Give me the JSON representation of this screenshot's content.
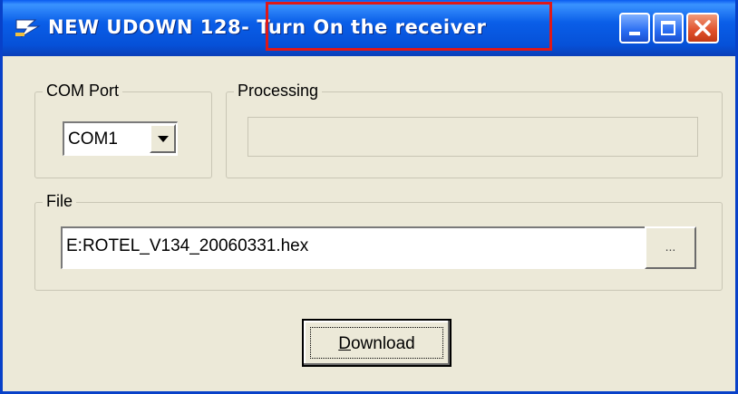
{
  "window": {
    "title": "NEW UDOWN 128-",
    "status": "Turn On the receiver"
  },
  "com_port": {
    "label": "COM Port",
    "selected": "COM1"
  },
  "processing": {
    "label": "Processing",
    "progress": 0
  },
  "file": {
    "label": "File",
    "path": "E:ROTEL_V134_20060331.hex",
    "browse_label": "..."
  },
  "download": {
    "mnemonic": "D",
    "rest": "ownload"
  },
  "colors": {
    "titlebar": "#0a5ee8",
    "highlight": "#e01818",
    "face": "#ece9d8"
  },
  "icons": [
    "app-icon",
    "minimize-icon",
    "maximize-icon",
    "close-icon",
    "dropdown-arrow-icon"
  ]
}
